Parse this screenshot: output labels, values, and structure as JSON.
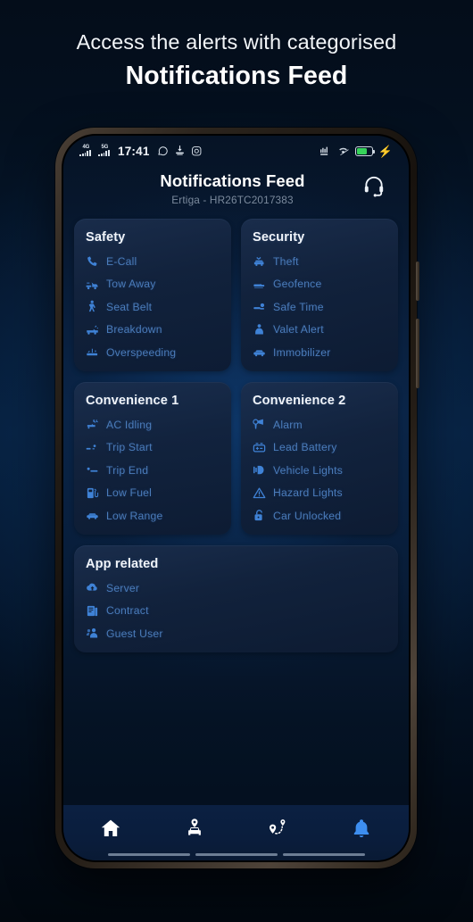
{
  "promo": {
    "line1": "Access the alerts with categorised",
    "line2": "Notifications Feed"
  },
  "statusbar": {
    "time": "17:41",
    "network_1": "4G",
    "network_2": "5G",
    "left_icons": [
      "signal-4g-icon",
      "signal-5g-icon",
      "whatsapp-icon",
      "download-icon",
      "camera-icon"
    ],
    "right_icons": [
      "lte-icon",
      "wifi-icon",
      "battery-icon",
      "charging-bolt-icon"
    ],
    "battery_color": "#36d35a",
    "bolt_color": "#f2c23a"
  },
  "header": {
    "title": "Notifications Feed",
    "subtitle": "Ertiga - HR26TC2017383",
    "support_icon": "headset-icon"
  },
  "theme": {
    "accent": "#3d8ef0",
    "item_text": "#4b7cba",
    "card_bg": "#16243d",
    "screen_bg": "#081a33"
  },
  "cards": [
    {
      "title": "Safety",
      "items": [
        {
          "label": "E-Call",
          "icon": "phone-icon"
        },
        {
          "label": "Tow Away",
          "icon": "tow-truck-icon"
        },
        {
          "label": "Seat Belt",
          "icon": "seat-belt-icon"
        },
        {
          "label": "Breakdown",
          "icon": "breakdown-car-icon"
        },
        {
          "label": "Overspeeding",
          "icon": "speedometer-icon"
        }
      ]
    },
    {
      "title": "Security",
      "items": [
        {
          "label": "Theft",
          "icon": "theft-icon"
        },
        {
          "label": "Geofence",
          "icon": "geofence-icon"
        },
        {
          "label": "Safe Time",
          "icon": "safe-time-icon"
        },
        {
          "label": "Valet Alert",
          "icon": "valet-icon"
        },
        {
          "label": "Immobilizer",
          "icon": "immobilizer-icon"
        }
      ]
    },
    {
      "title": "Convenience 1",
      "items": [
        {
          "label": "AC Idling",
          "icon": "ac-idling-icon"
        },
        {
          "label": "Trip Start",
          "icon": "trip-start-icon"
        },
        {
          "label": "Trip End",
          "icon": "trip-end-icon"
        },
        {
          "label": "Low Fuel",
          "icon": "fuel-pump-icon"
        },
        {
          "label": "Low Range",
          "icon": "low-range-icon"
        }
      ]
    },
    {
      "title": "Convenience 2",
      "items": [
        {
          "label": "Alarm",
          "icon": "alarm-siren-icon"
        },
        {
          "label": "Lead Battery",
          "icon": "battery-icon"
        },
        {
          "label": "Vehicle Lights",
          "icon": "headlight-icon"
        },
        {
          "label": "Hazard Lights",
          "icon": "hazard-triangle-icon"
        },
        {
          "label": "Car Unlocked",
          "icon": "unlock-icon"
        }
      ]
    },
    {
      "title": "App related",
      "items": [
        {
          "label": "Server",
          "icon": "server-cloud-icon"
        },
        {
          "label": "Contract",
          "icon": "contract-icon"
        },
        {
          "label": "Guest User",
          "icon": "guest-user-icon"
        }
      ]
    }
  ],
  "bottom_nav": [
    {
      "icon": "home-icon",
      "active": false
    },
    {
      "icon": "vehicle-pin-icon",
      "active": false
    },
    {
      "icon": "trip-route-icon",
      "active": false
    },
    {
      "icon": "bell-icon",
      "active": true
    }
  ]
}
